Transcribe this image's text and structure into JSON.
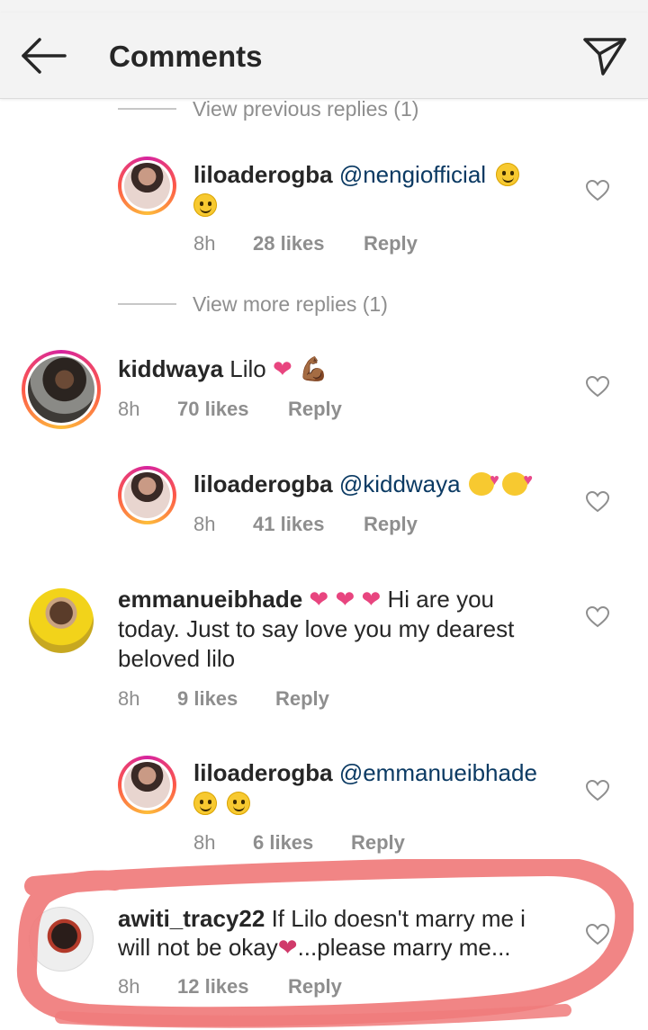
{
  "header": {
    "title": "Comments",
    "back_icon": "arrow-left-icon",
    "send_icon": "paper-plane-icon"
  },
  "threads": {
    "view_previous": "View previous replies (1)",
    "view_more": "View more replies (1)"
  },
  "comments": [
    {
      "username": "liloaderogba",
      "mention": "@nengiofficial",
      "time": "8h",
      "likes": "28 likes",
      "reply": "Reply"
    },
    {
      "username": "kiddwaya",
      "text": "Lilo",
      "glyph": "💪🏾",
      "time": "8h",
      "likes": "70 likes",
      "reply": "Reply"
    },
    {
      "username": "liloaderogba",
      "mention": "@kiddwaya",
      "time": "8h",
      "likes": "41 likes",
      "reply": "Reply"
    },
    {
      "username": "emmanueibhade",
      "text_line1": "Hi are you",
      "text_line2": "today. Just to say love you my dearest",
      "text_line3": "beloved lilo",
      "time": "8h",
      "likes": "9 likes",
      "reply": "Reply"
    },
    {
      "username": "liloaderogba",
      "mention": "@emmanueibhade",
      "time": "8h",
      "likes": "6 likes",
      "reply": "Reply"
    },
    {
      "username": "awiti_tracy22",
      "text_line1": "If Lilo doesn't marry me i",
      "text_line2a": "will not be okay",
      "text_line2b": "...please marry me...",
      "time": "8h",
      "likes": "12 likes",
      "reply": "Reply"
    }
  ],
  "colors": {
    "mention": "#0b3a63",
    "meta": "#8e8e8e",
    "highlight_scribble": "#f07b7b"
  }
}
